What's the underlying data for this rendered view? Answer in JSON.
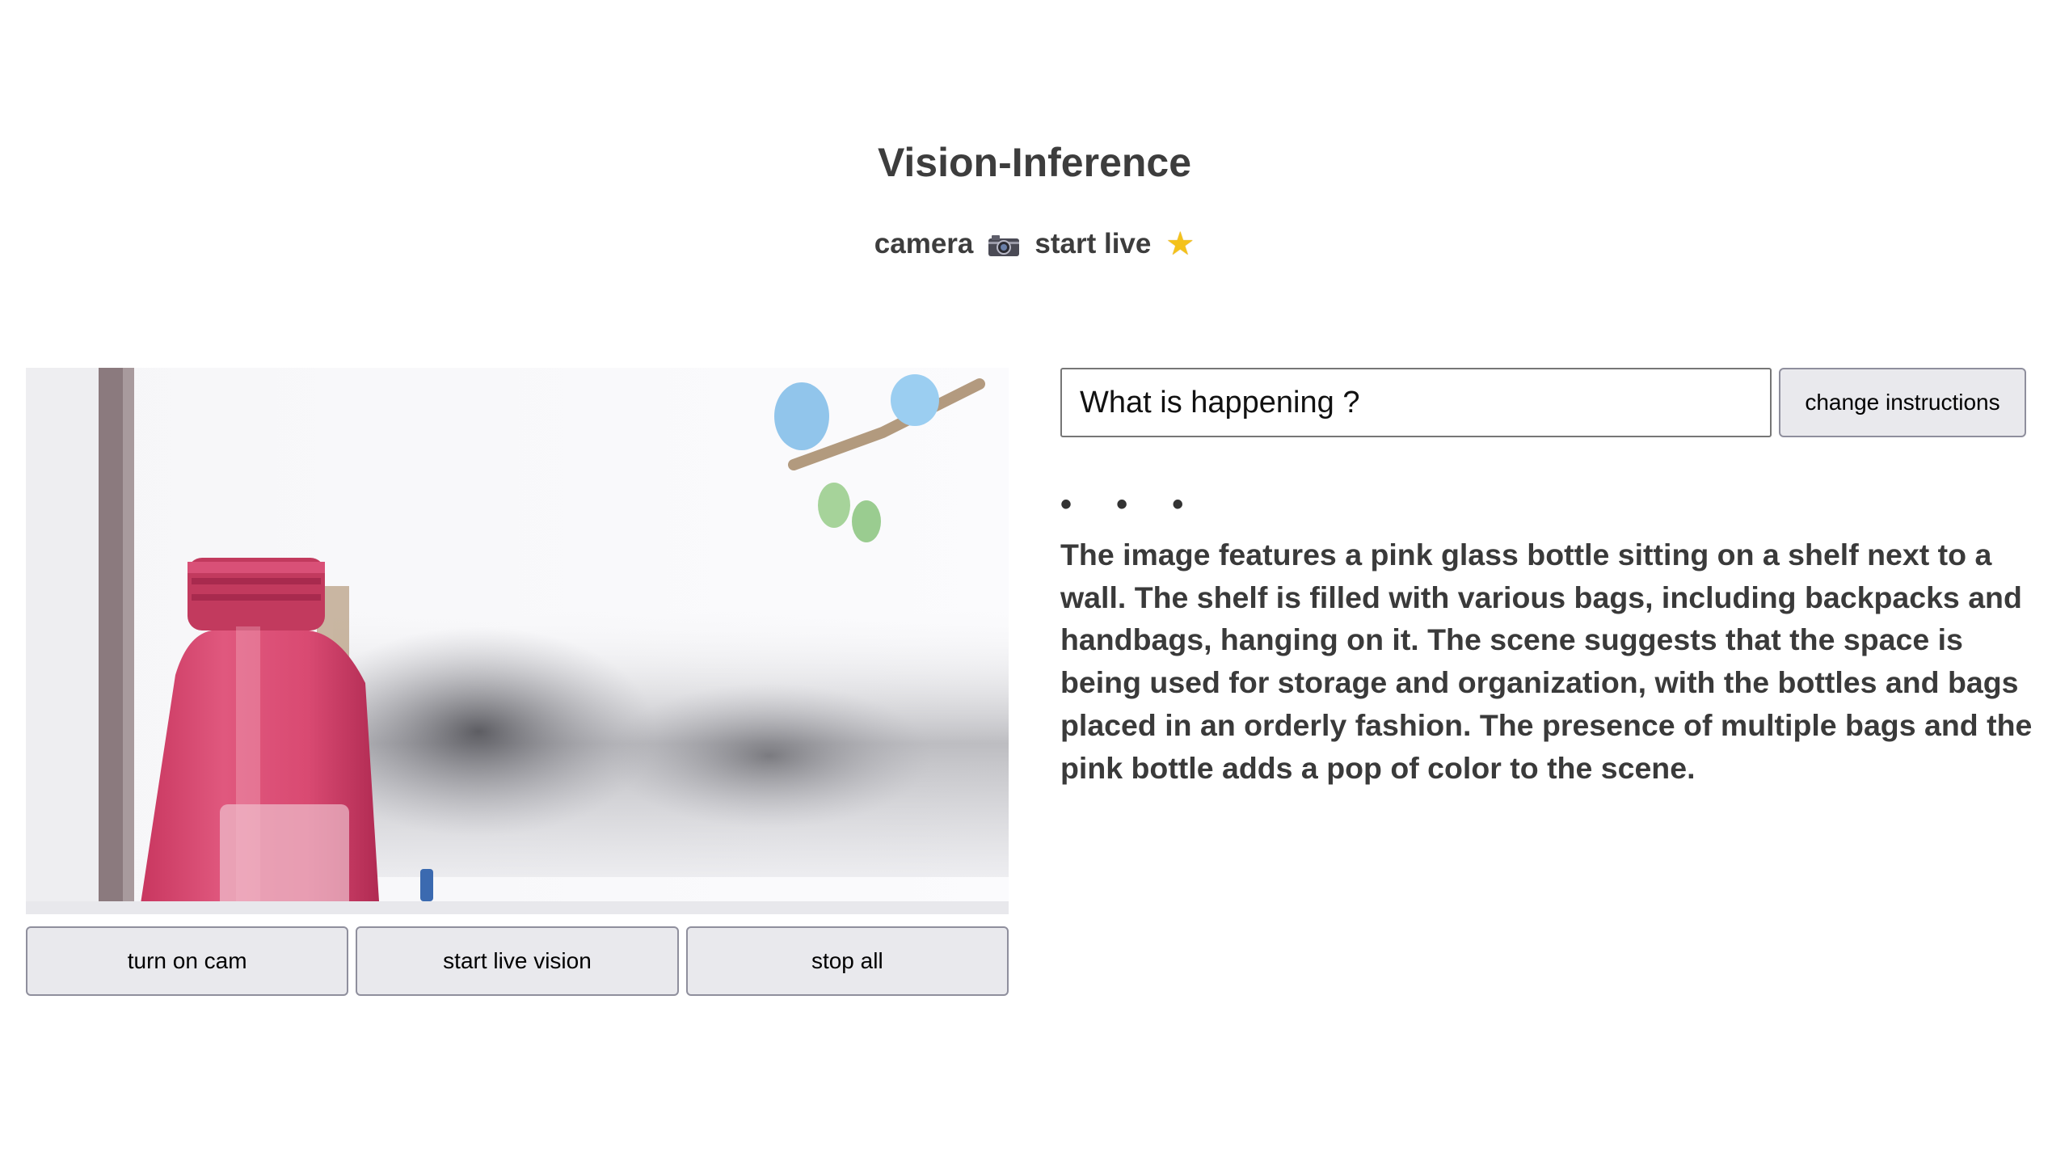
{
  "header": {
    "title": "Vision-Inference",
    "camera_label": "camera",
    "camera_icon": "camera-icon",
    "live_label": "start live",
    "live_icon": "star-icon"
  },
  "video": {
    "icon": "webcam-feed"
  },
  "controls": {
    "turn_on_cam": "turn on cam",
    "start_live_vision": "start live vision",
    "stop_all": "stop all"
  },
  "instructions": {
    "value": "What is happening ?",
    "button_label": "change instructions"
  },
  "status": {
    "dots": "• • •"
  },
  "output": {
    "text": "The image features a pink glass bottle sitting on a shelf next to a wall. The shelf is filled with various bags, including backpacks and handbags, hanging on it. The scene suggests that the space is being used for storage and organization, with the bottles and bags placed in an orderly fashion. The presence of multiple bags and the pink bottle adds a pop of color to the scene."
  },
  "colors": {
    "text": "#3a3a3a",
    "button_bg": "#e9e9ed",
    "button_border": "#8f8f9d",
    "bottle": "#d94a72"
  }
}
